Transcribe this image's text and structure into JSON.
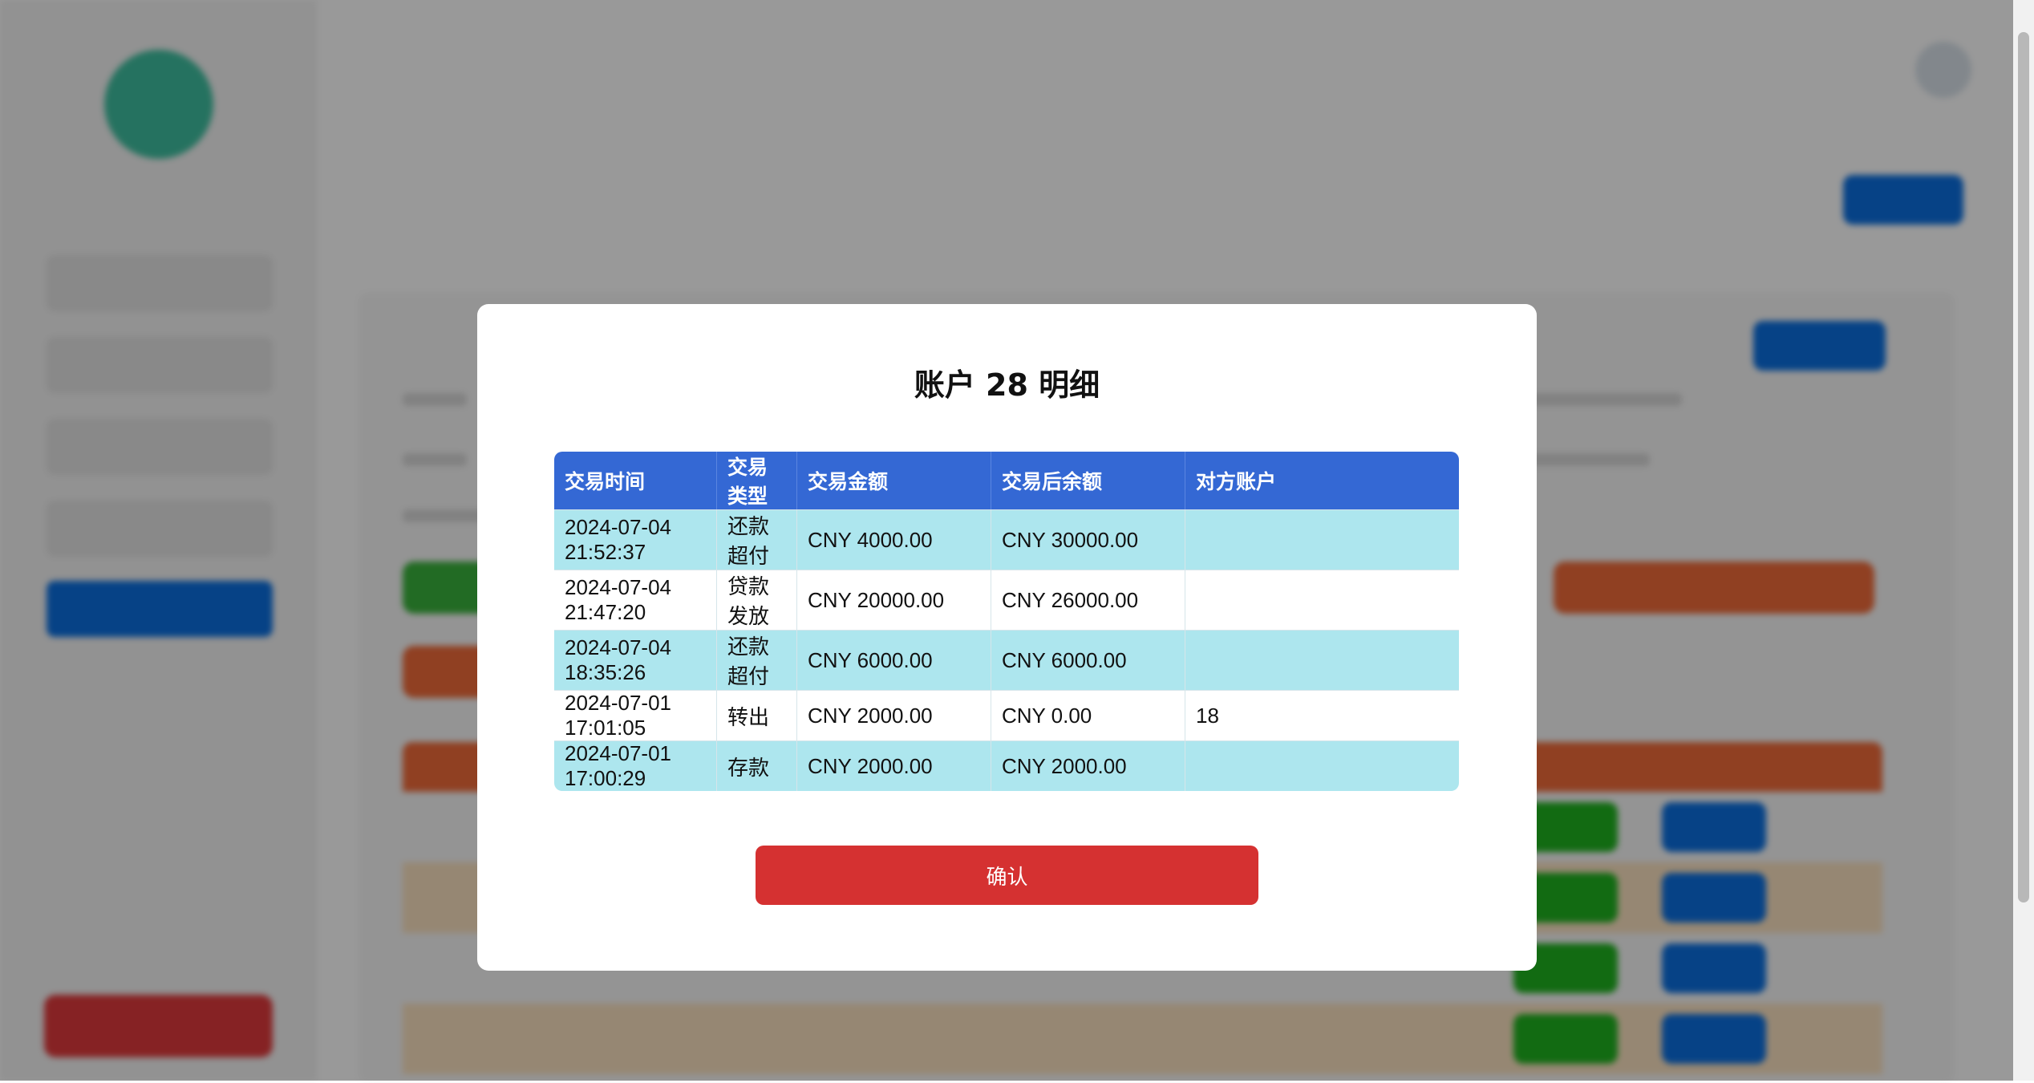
{
  "modal": {
    "title": "账户 28 明细",
    "columns": [
      "交易时间",
      "交易类型",
      "交易金额",
      "交易后余额",
      "对方账户"
    ],
    "rows": [
      {
        "time": "2024-07-04 21:52:37",
        "type": "还款超付",
        "amount": "CNY 4000.00",
        "balance": "CNY 30000.00",
        "counterparty": ""
      },
      {
        "time": "2024-07-04 21:47:20",
        "type": "贷款发放",
        "amount": "CNY 20000.00",
        "balance": "CNY 26000.00",
        "counterparty": ""
      },
      {
        "time": "2024-07-04 18:35:26",
        "type": "还款超付",
        "amount": "CNY 6000.00",
        "balance": "CNY 6000.00",
        "counterparty": ""
      },
      {
        "time": "2024-07-01 17:01:05",
        "type": "转出",
        "amount": "CNY 2000.00",
        "balance": "CNY 0.00",
        "counterparty": "18"
      },
      {
        "time": "2024-07-01 17:00:29",
        "type": "存款",
        "amount": "CNY 2000.00",
        "balance": "CNY 2000.00",
        "counterparty": ""
      }
    ],
    "confirm_label": "确认"
  },
  "colors": {
    "table_header": "#3468d4",
    "row_highlight": "#ade6ee",
    "confirm": "#d53131",
    "greeting": "#25b59a",
    "accent_orange": "#f06b3a",
    "accent_blue": "#0b6fe0"
  }
}
